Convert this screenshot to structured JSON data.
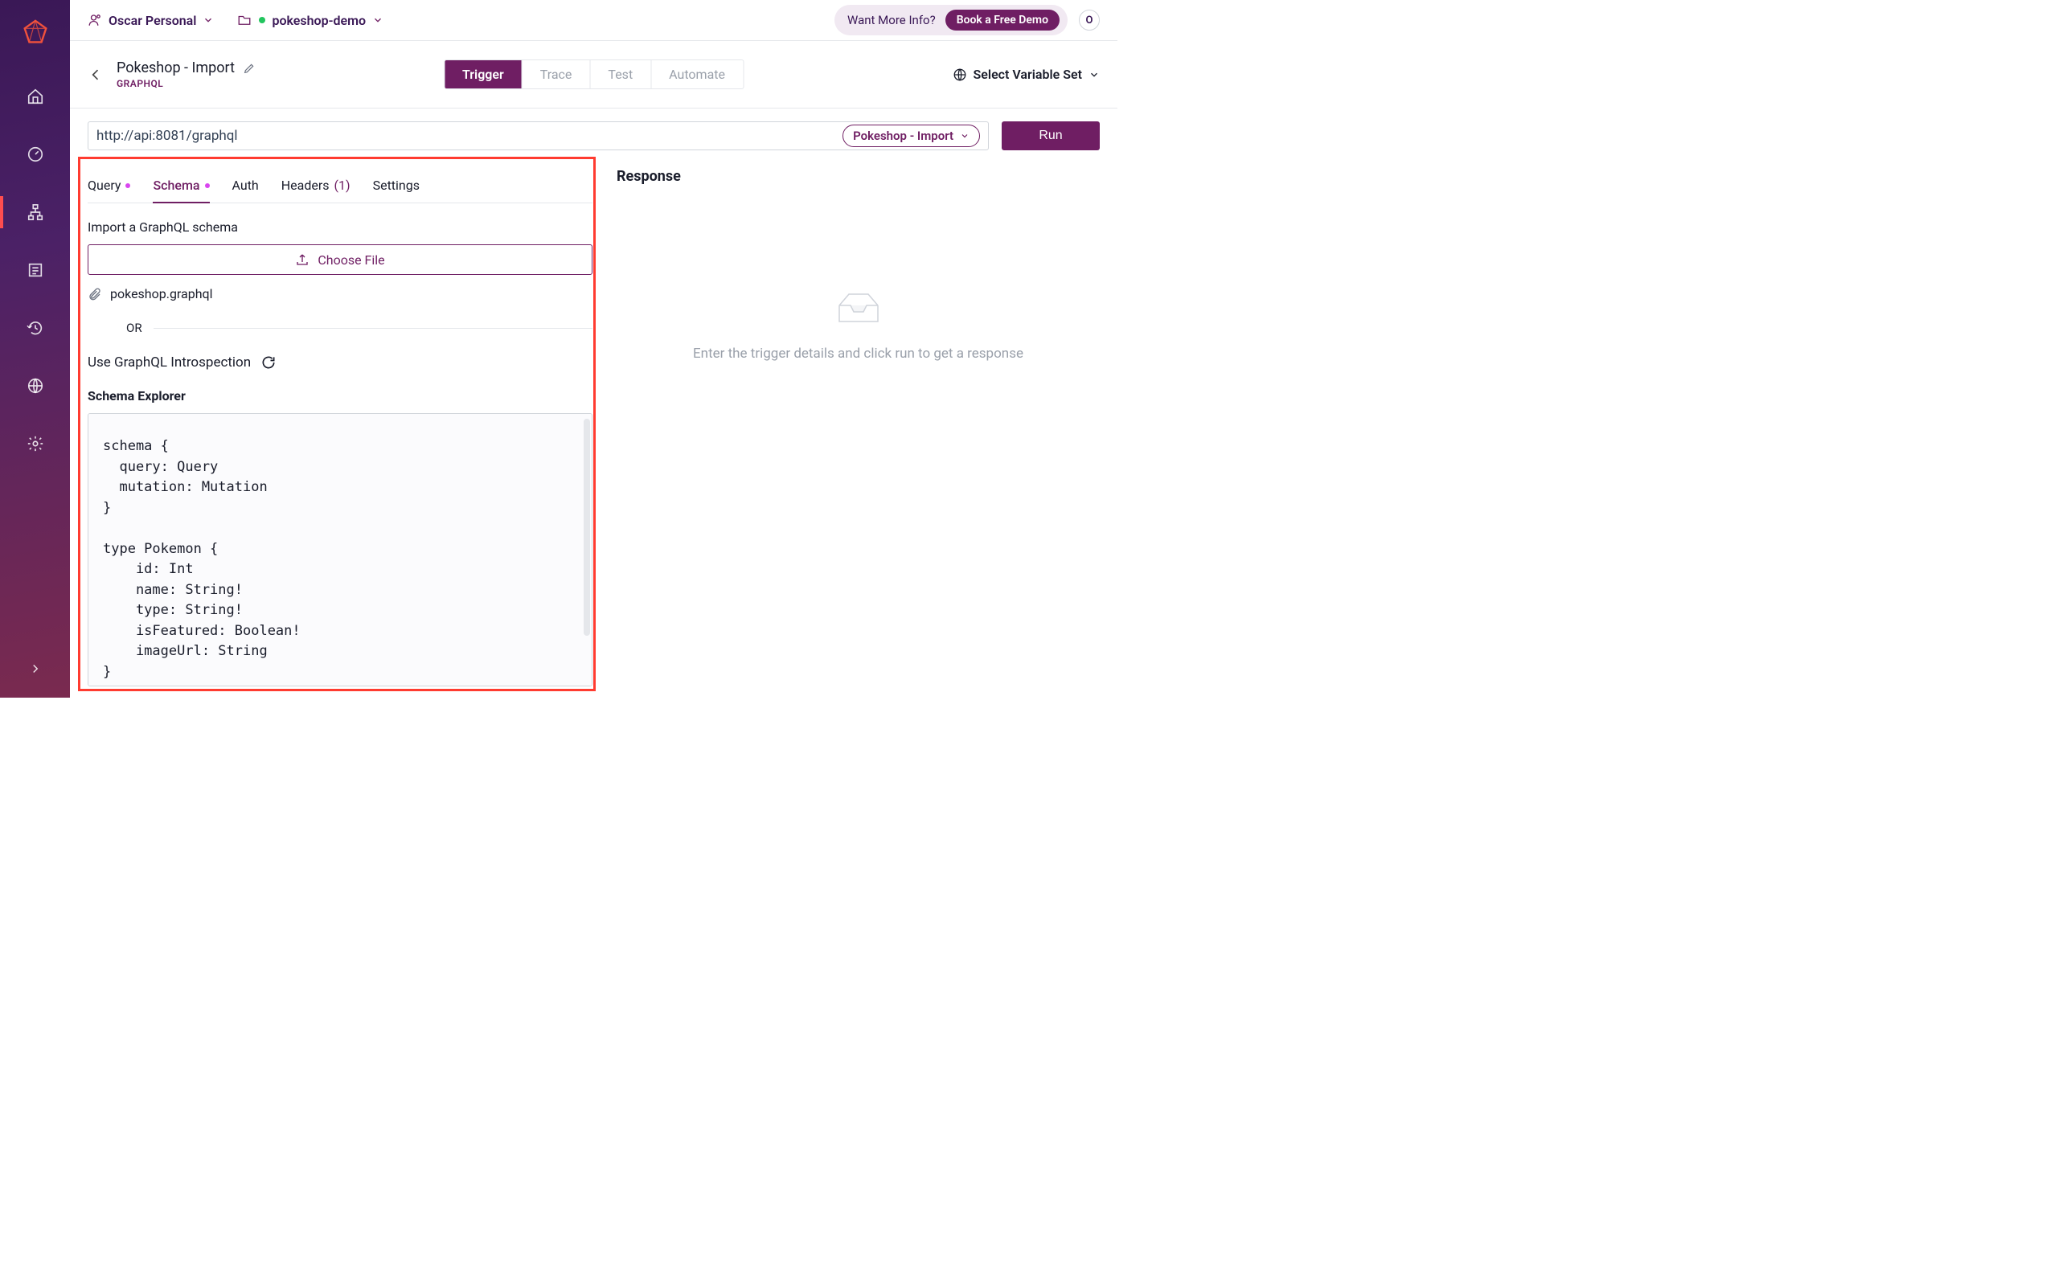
{
  "topbar": {
    "org": "Oscar Personal",
    "project": "pokeshop-demo",
    "wantInfo": "Want More Info?",
    "demoBtn": "Book a Free Demo",
    "avatar": "O"
  },
  "header": {
    "title": "Pokeshop - Import",
    "subtype": "GRAPHQL",
    "modes": [
      "Trigger",
      "Trace",
      "Test",
      "Automate"
    ],
    "activeMode": "Trigger",
    "varset": "Select Variable Set"
  },
  "url": {
    "value": "http://api:8081/graphql",
    "selectLabel": "Pokeshop - Import",
    "runLabel": "Run"
  },
  "reqTabs": {
    "query": "Query",
    "schema": "Schema",
    "auth": "Auth",
    "headers": "Headers",
    "headersCount": "(1)",
    "settings": "Settings"
  },
  "schema": {
    "importLabel": "Import a GraphQL schema",
    "chooseFile": "Choose File",
    "fileName": "pokeshop.graphql",
    "or": "OR",
    "introspection": "Use GraphQL Introspection",
    "explorerTitle": "Schema Explorer",
    "code": "schema {\n  query: Query\n  mutation: Mutation\n}\n\ntype Pokemon {\n    id: Int\n    name: String!\n    type: String!\n    isFeatured: Boolean!\n    imageUrl: String\n}"
  },
  "response": {
    "title": "Response",
    "emptyText": "Enter the trigger details and click run to get a response"
  }
}
